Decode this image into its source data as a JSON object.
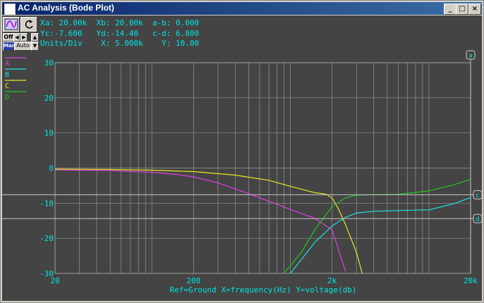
{
  "window": {
    "title": "AC Analysis (Bode Plot)",
    "min_glyph": "_",
    "max_glyph": "□",
    "close_glyph": "×"
  },
  "toolbar": {
    "off_label": "Off",
    "man_label": "Man",
    "auto_label": "Auto"
  },
  "readout": {
    "line1": "Xa: 20.00k  Xb: 20.00k  a-b: 0.000",
    "line2": "Yc:-7.600   Yd:-14.40   c-d: 6.800",
    "line3": "Units/Div    X: 5.000k    Y: 10.00"
  },
  "cursors": {
    "a_label": "a",
    "c_label": "c",
    "d_label": "d",
    "c_value": -7.6,
    "d_value": -14.4,
    "a_x": 20000
  },
  "colors": {
    "background": "#444444",
    "grid": "#a8a8a8",
    "axis_text": "#00e5e5",
    "A": "#e040e0",
    "B": "#20e0e0",
    "C": "#e8e820",
    "D": "#20c820"
  },
  "chart_data": {
    "type": "line",
    "xscale": "log",
    "xlim": [
      20,
      20000
    ],
    "ylim": [
      -30,
      30
    ],
    "grid": true,
    "legend_position": "top-left",
    "xlabel": "Ref=Ground  X=frequency(Hz) Y=voltage(db)",
    "x_tick_labels": [
      "20",
      "200",
      "2k",
      "20k"
    ],
    "x_tick_values": [
      20,
      200,
      2000,
      20000
    ],
    "y_tick_labels": [
      "30",
      "20",
      "10",
      "0",
      "-10",
      "-20",
      "-30"
    ],
    "y_tick_values": [
      30,
      20,
      10,
      0,
      -10,
      -20,
      -30
    ],
    "series": [
      {
        "name": "A",
        "color": "#e040e0",
        "x": [
          20,
          50,
          100,
          150,
          200,
          300,
          500,
          800,
          1000,
          1500,
          2000,
          2500
        ],
        "y": [
          -0.5,
          -0.7,
          -1.2,
          -1.8,
          -2.5,
          -4.2,
          -7.3,
          -10.3,
          -11.8,
          -14.3,
          -17.6,
          -29.4
        ]
      },
      {
        "name": "B",
        "color": "#20e0e0",
        "x": [
          1000,
          1500,
          2000,
          2500,
          3000,
          4000,
          6000,
          10000,
          15000,
          20000
        ],
        "y": [
          -30,
          -21.2,
          -16.5,
          -14.0,
          -12.8,
          -12.3,
          -12.1,
          -11.9,
          -10.2,
          -8.4
        ]
      },
      {
        "name": "C",
        "color": "#e8e820",
        "x": [
          20,
          50,
          100,
          200,
          400,
          700,
          1000,
          1500,
          1800,
          2000,
          2200,
          2500,
          3000,
          3300
        ],
        "y": [
          -0.3,
          -0.4,
          -0.6,
          -1.0,
          -2.0,
          -3.5,
          -5.2,
          -7.0,
          -7.4,
          -8.5,
          -11.3,
          -16.1,
          -24.0,
          -30
        ]
      },
      {
        "name": "D",
        "color": "#20c820",
        "x": [
          900,
          1200,
          1500,
          2000,
          2500,
          3000,
          4000,
          6000,
          10000,
          15000,
          20000
        ],
        "y": [
          -30,
          -24.0,
          -17.6,
          -11.0,
          -8.5,
          -7.7,
          -7.6,
          -7.5,
          -6.5,
          -4.8,
          -3.2
        ]
      }
    ]
  }
}
